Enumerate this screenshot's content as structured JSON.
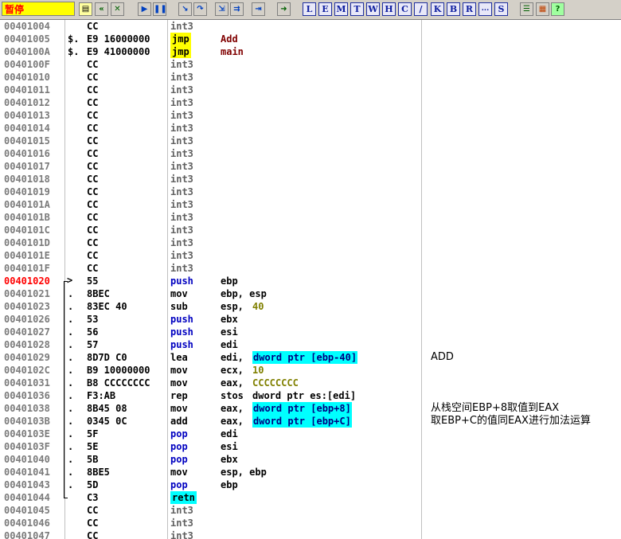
{
  "toolbar": {
    "status": "暂停",
    "letter_buttons": [
      "L",
      "E",
      "M",
      "T",
      "W",
      "H",
      "C",
      "/",
      "K",
      "B",
      "R",
      "...",
      "S"
    ]
  },
  "rows": [
    {
      "addr": "00401004",
      "mark": "",
      "hex": "CC",
      "mn": "int3",
      "mn_style": "plain",
      "op": "",
      "op2": "",
      "op2_style": "",
      "comment": ""
    },
    {
      "addr": "00401005",
      "mark": "$.",
      "hex": "E9 16000000",
      "mn": "jmp",
      "mn_style": "hl-y",
      "op": "Add",
      "op_style": "lbl",
      "op2": "",
      "op2_style": "",
      "comment": ""
    },
    {
      "addr": "0040100A",
      "mark": "$.",
      "hex": "E9 41000000",
      "mn": "jmp",
      "mn_style": "hl-y",
      "op": "main",
      "op_style": "lbl",
      "op2": "",
      "op2_style": "",
      "comment": ""
    },
    {
      "addr": "0040100F",
      "mark": "",
      "hex": "CC",
      "mn": "int3",
      "mn_style": "plain",
      "op": "",
      "op2": "",
      "op2_style": "",
      "comment": ""
    },
    {
      "addr": "00401010",
      "mark": "",
      "hex": "CC",
      "mn": "int3",
      "mn_style": "plain",
      "op": "",
      "op2": "",
      "op2_style": "",
      "comment": ""
    },
    {
      "addr": "00401011",
      "mark": "",
      "hex": "CC",
      "mn": "int3",
      "mn_style": "plain",
      "op": "",
      "op2": "",
      "op2_style": "",
      "comment": ""
    },
    {
      "addr": "00401012",
      "mark": "",
      "hex": "CC",
      "mn": "int3",
      "mn_style": "plain",
      "op": "",
      "op2": "",
      "op2_style": "",
      "comment": ""
    },
    {
      "addr": "00401013",
      "mark": "",
      "hex": "CC",
      "mn": "int3",
      "mn_style": "plain",
      "op": "",
      "op2": "",
      "op2_style": "",
      "comment": ""
    },
    {
      "addr": "00401014",
      "mark": "",
      "hex": "CC",
      "mn": "int3",
      "mn_style": "plain",
      "op": "",
      "op2": "",
      "op2_style": "",
      "comment": ""
    },
    {
      "addr": "00401015",
      "mark": "",
      "hex": "CC",
      "mn": "int3",
      "mn_style": "plain",
      "op": "",
      "op2": "",
      "op2_style": "",
      "comment": ""
    },
    {
      "addr": "00401016",
      "mark": "",
      "hex": "CC",
      "mn": "int3",
      "mn_style": "plain",
      "op": "",
      "op2": "",
      "op2_style": "",
      "comment": ""
    },
    {
      "addr": "00401017",
      "mark": "",
      "hex": "CC",
      "mn": "int3",
      "mn_style": "plain",
      "op": "",
      "op2": "",
      "op2_style": "",
      "comment": ""
    },
    {
      "addr": "00401018",
      "mark": "",
      "hex": "CC",
      "mn": "int3",
      "mn_style": "plain",
      "op": "",
      "op2": "",
      "op2_style": "",
      "comment": ""
    },
    {
      "addr": "00401019",
      "mark": "",
      "hex": "CC",
      "mn": "int3",
      "mn_style": "plain",
      "op": "",
      "op2": "",
      "op2_style": "",
      "comment": ""
    },
    {
      "addr": "0040101A",
      "mark": "",
      "hex": "CC",
      "mn": "int3",
      "mn_style": "plain",
      "op": "",
      "op2": "",
      "op2_style": "",
      "comment": ""
    },
    {
      "addr": "0040101B",
      "mark": "",
      "hex": "CC",
      "mn": "int3",
      "mn_style": "plain",
      "op": "",
      "op2": "",
      "op2_style": "",
      "comment": ""
    },
    {
      "addr": "0040101C",
      "mark": "",
      "hex": "CC",
      "mn": "int3",
      "mn_style": "plain",
      "op": "",
      "op2": "",
      "op2_style": "",
      "comment": ""
    },
    {
      "addr": "0040101D",
      "mark": "",
      "hex": "CC",
      "mn": "int3",
      "mn_style": "plain",
      "op": "",
      "op2": "",
      "op2_style": "",
      "comment": ""
    },
    {
      "addr": "0040101E",
      "mark": "",
      "hex": "CC",
      "mn": "int3",
      "mn_style": "plain",
      "op": "",
      "op2": "",
      "op2_style": "",
      "comment": ""
    },
    {
      "addr": "0040101F",
      "mark": "",
      "hex": "CC",
      "mn": "int3",
      "mn_style": "plain",
      "op": "",
      "op2": "",
      "op2_style": "",
      "comment": ""
    },
    {
      "addr": "00401020",
      "mark": "",
      "hex": "55",
      "mn": "push",
      "mn_style": "push",
      "op": "ebp",
      "op2": "",
      "op2_style": "",
      "comment": "",
      "current": true
    },
    {
      "addr": "00401021",
      "mark": ".",
      "hex": "8BEC",
      "mn": "mov",
      "mn_style": "call",
      "op": "ebp, esp",
      "op2": "",
      "op2_style": "",
      "comment": ""
    },
    {
      "addr": "00401023",
      "mark": ".",
      "hex": "83EC 40",
      "mn": "sub",
      "mn_style": "call",
      "op": "esp,",
      "op2": "40",
      "op2_style": "num",
      "comment": ""
    },
    {
      "addr": "00401026",
      "mark": ".",
      "hex": "53",
      "mn": "push",
      "mn_style": "push",
      "op": "ebx",
      "op2": "",
      "op2_style": "",
      "comment": ""
    },
    {
      "addr": "00401027",
      "mark": ".",
      "hex": "56",
      "mn": "push",
      "mn_style": "push",
      "op": "esi",
      "op2": "",
      "op2_style": "",
      "comment": ""
    },
    {
      "addr": "00401028",
      "mark": ".",
      "hex": "57",
      "mn": "push",
      "mn_style": "push",
      "op": "edi",
      "op2": "",
      "op2_style": "",
      "comment": ""
    },
    {
      "addr": "00401029",
      "mark": ".",
      "hex": "8D7D C0",
      "mn": "lea",
      "mn_style": "call",
      "op": "edi,",
      "op2": "dword ptr [ebp-40]",
      "op2_style": "mem",
      "comment": "ADD"
    },
    {
      "addr": "0040102C",
      "mark": ".",
      "hex": "B9 10000000",
      "mn": "mov",
      "mn_style": "call",
      "op": "ecx,",
      "op2": "10",
      "op2_style": "num",
      "comment": ""
    },
    {
      "addr": "00401031",
      "mark": ".",
      "hex": "B8 CCCCCCCC",
      "mn": "mov",
      "mn_style": "call",
      "op": "eax,",
      "op2": "CCCCCCCC",
      "op2_style": "num",
      "comment": ""
    },
    {
      "addr": "00401036",
      "mark": ".",
      "hex": "F3:AB",
      "mn": "rep",
      "mn_style": "call",
      "op": "stos",
      "op2": "dword ptr es:[edi]",
      "op2_style": "",
      "comment": ""
    },
    {
      "addr": "00401038",
      "mark": ".",
      "hex": "8B45 08",
      "mn": "mov",
      "mn_style": "call",
      "op": "eax,",
      "op2": "dword ptr [ebp+8]",
      "op2_style": "mem",
      "comment": "从栈空间EBP+8取值到EAX"
    },
    {
      "addr": "0040103B",
      "mark": ".",
      "hex": "0345 0C",
      "mn": "add",
      "mn_style": "call",
      "op": "eax,",
      "op2": "dword ptr [ebp+C]",
      "op2_style": "mem",
      "comment": "取EBP+C的值同EAX进行加法运算"
    },
    {
      "addr": "0040103E",
      "mark": ".",
      "hex": "5F",
      "mn": "pop",
      "mn_style": "push",
      "op": "edi",
      "op2": "",
      "op2_style": "",
      "comment": ""
    },
    {
      "addr": "0040103F",
      "mark": ".",
      "hex": "5E",
      "mn": "pop",
      "mn_style": "push",
      "op": "esi",
      "op2": "",
      "op2_style": "",
      "comment": ""
    },
    {
      "addr": "00401040",
      "mark": ".",
      "hex": "5B",
      "mn": "pop",
      "mn_style": "push",
      "op": "ebx",
      "op2": "",
      "op2_style": "",
      "comment": ""
    },
    {
      "addr": "00401041",
      "mark": ".",
      "hex": "8BE5",
      "mn": "mov",
      "mn_style": "call",
      "op": "esp, ebp",
      "op2": "",
      "op2_style": "",
      "comment": ""
    },
    {
      "addr": "00401043",
      "mark": ".",
      "hex": "5D",
      "mn": "pop",
      "mn_style": "push",
      "op": "ebp",
      "op2": "",
      "op2_style": "",
      "comment": ""
    },
    {
      "addr": "00401044",
      "mark": "",
      "hex": "C3",
      "mn": "retn",
      "mn_style": "hl-c",
      "op": "",
      "op2": "",
      "op2_style": "",
      "comment": ""
    },
    {
      "addr": "00401045",
      "mark": "",
      "hex": "CC",
      "mn": "int3",
      "mn_style": "plain",
      "op": "",
      "op2": "",
      "op2_style": "",
      "comment": ""
    },
    {
      "addr": "00401046",
      "mark": "",
      "hex": "CC",
      "mn": "int3",
      "mn_style": "plain",
      "op": "",
      "op2": "",
      "op2_style": "",
      "comment": ""
    },
    {
      "addr": "00401047",
      "mark": "",
      "hex": "CC",
      "mn": "int3",
      "mn_style": "plain",
      "op": "",
      "op2": "",
      "op2_style": "",
      "comment": ""
    }
  ]
}
